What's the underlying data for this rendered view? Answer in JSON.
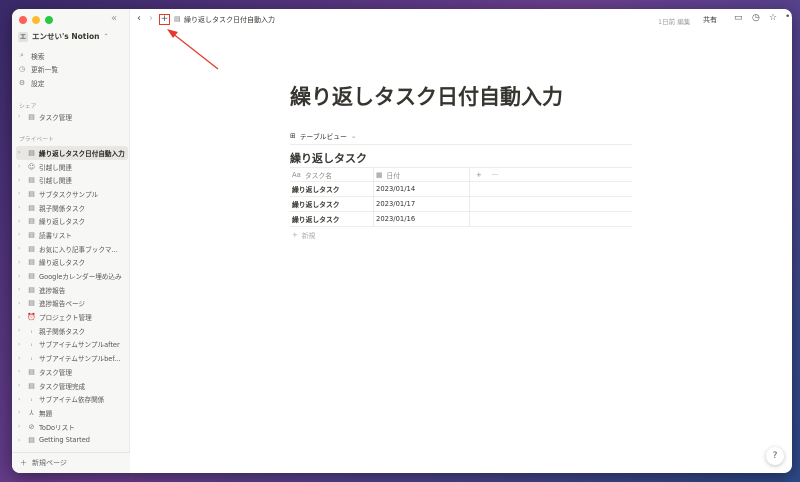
{
  "workspace": {
    "name": "エンせい's Notion",
    "icon_letter": "エ"
  },
  "menu": [
    {
      "icon": "search-icon",
      "glyph": "⌕",
      "label": "検索"
    },
    {
      "icon": "clock-icon",
      "glyph": "◷",
      "label": "更新一覧"
    },
    {
      "icon": "gear-icon",
      "glyph": "⚙",
      "label": "設定"
    }
  ],
  "sections": {
    "shared": "シェア",
    "private": "プライベート"
  },
  "shared_pages": [
    {
      "label": "タスク管理"
    }
  ],
  "private_pages": [
    {
      "label": "繰り返しタスク日付自動入力",
      "glyph": "▤",
      "active": true
    },
    {
      "label": "引越し関連",
      "glyph": "☺"
    },
    {
      "label": "引越し関連",
      "glyph": "▤"
    },
    {
      "label": "サブタスクサンプル",
      "glyph": "▤"
    },
    {
      "label": "親子関係タスク",
      "glyph": "▤"
    },
    {
      "label": "繰り返しタスク",
      "glyph": "▤"
    },
    {
      "label": "読書リスト",
      "glyph": "▤"
    },
    {
      "label": "お気に入り記事ブックマ...",
      "glyph": "▤"
    },
    {
      "label": "繰り返しタスク",
      "glyph": "▤"
    },
    {
      "label": "Googleカレンダー埋め込み",
      "glyph": "▤"
    },
    {
      "label": "進捗報告",
      "glyph": "▤"
    },
    {
      "label": "進捗報告ページ",
      "glyph": "▤"
    },
    {
      "label": "プロジェクト管理",
      "glyph": "⏰"
    },
    {
      "label": "親子関係タスク",
      "glyph": "ꜟ"
    },
    {
      "label": "サブアイテムサンプルafter",
      "glyph": "ꜟ"
    },
    {
      "label": "サブアイテムサンプルbef...",
      "glyph": "ꜟ"
    },
    {
      "label": "タスク管理",
      "glyph": "▤"
    },
    {
      "label": "タスク管理完成",
      "glyph": "▤"
    },
    {
      "label": "サブアイテム依存関係",
      "glyph": "ꜟ"
    },
    {
      "label": "無題",
      "glyph": "⅄"
    },
    {
      "label": "ToDoリスト",
      "glyph": "⊘"
    },
    {
      "label": "Getting Started",
      "glyph": "▤"
    }
  ],
  "new_page_label": "新規ページ",
  "topbar": {
    "breadcrumb": "繰り返しタスク日付自動入力",
    "edited": "1日前 編集",
    "share": "共有"
  },
  "page": {
    "title": "繰り返しタスク日付自動入力",
    "view_label": "テーブルビュー",
    "db_title": "繰り返しタスク",
    "columns": {
      "name": "タスク名",
      "name_prefix": "Aa",
      "date": "日付"
    },
    "rows": [
      {
        "name": "繰り返しタスク",
        "date": "2023/01/14"
      },
      {
        "name": "繰り返しタスク",
        "date": "2023/01/17"
      },
      {
        "name": "繰り返しタスク",
        "date": "2023/01/16"
      }
    ],
    "new_row_label": "新規"
  },
  "help_label": "?",
  "colors": {
    "highlight": "#e23b2e",
    "sidebar_bg": "#f7f7f5",
    "text": "#37352f"
  }
}
